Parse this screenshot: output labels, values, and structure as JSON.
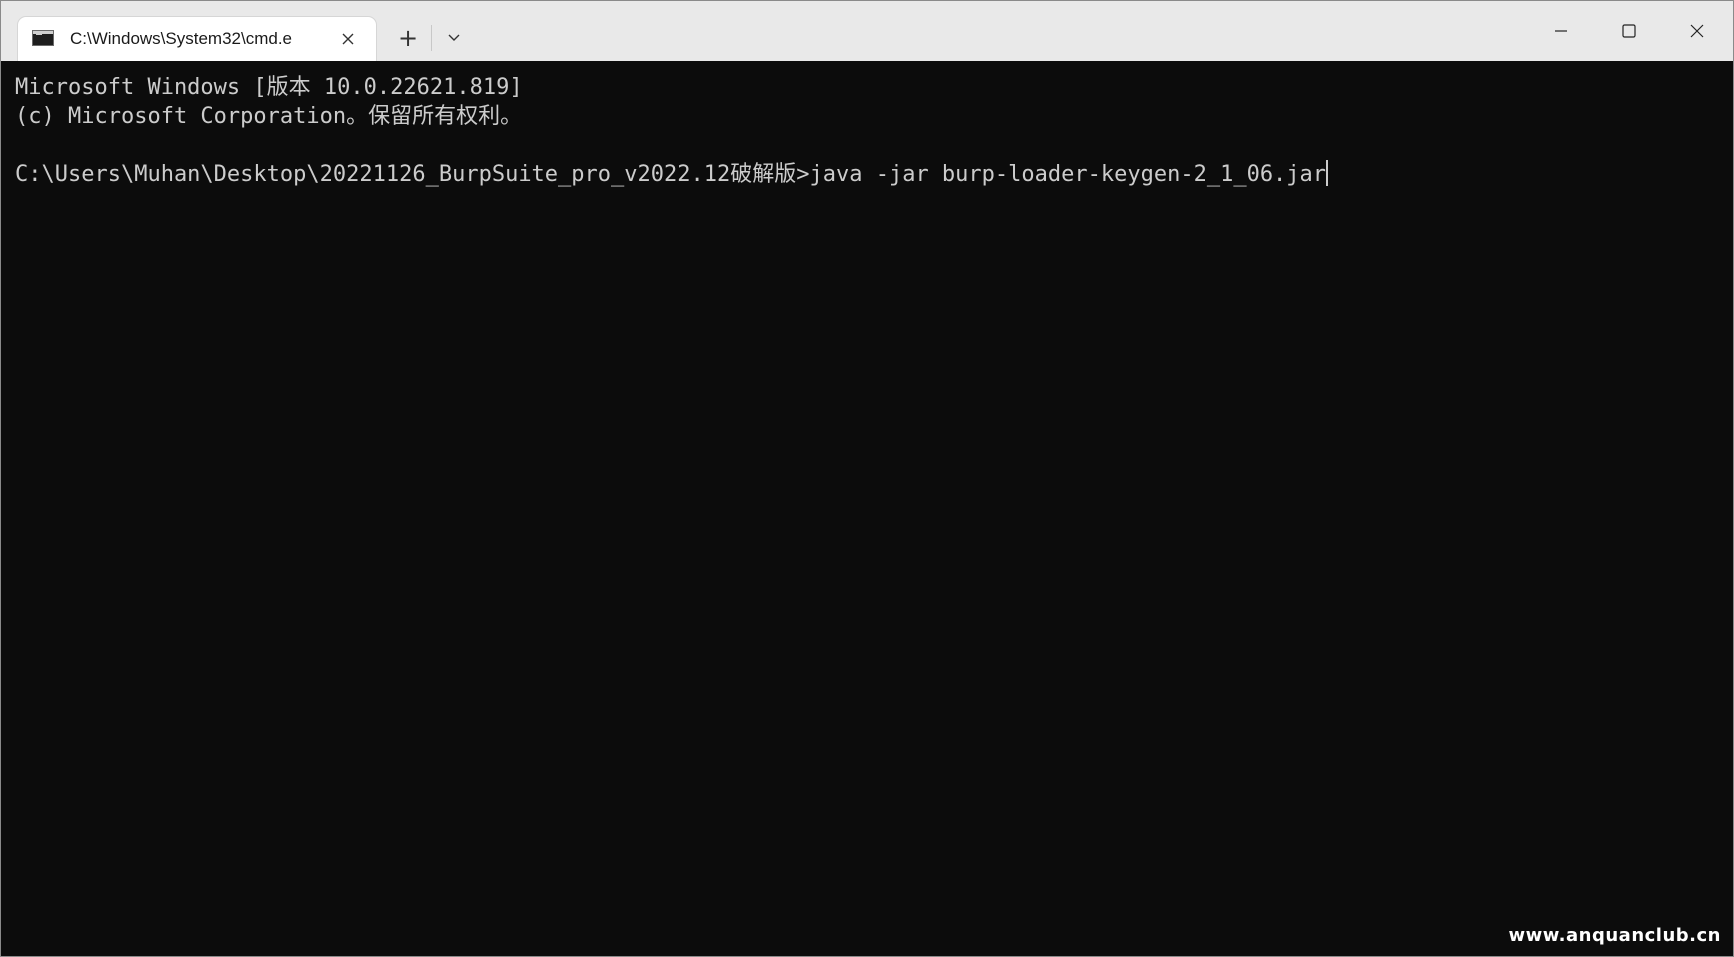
{
  "window": {
    "tab_title": "C:\\Windows\\System32\\cmd.e",
    "tab_icon": "terminal-icon",
    "new_tab_label": "+",
    "close_tab_label": "✕",
    "minimize_icon": "minimize-icon",
    "maximize_icon": "maximize-icon",
    "close_icon": "close-icon"
  },
  "terminal": {
    "lines": [
      "Microsoft Windows [版本 10.0.22621.819]",
      "(c) Microsoft Corporation。保留所有权利。",
      "",
      "C:\\Users\\Muhan\\Desktop\\20221126_BurpSuite_pro_v2022.12破解版>java -jar burp-loader-keygen-2_1_06.jar"
    ],
    "foreground_color": "#cccccc",
    "background_color": "#0c0c0c"
  },
  "watermark": "www.anquanclub.cn"
}
